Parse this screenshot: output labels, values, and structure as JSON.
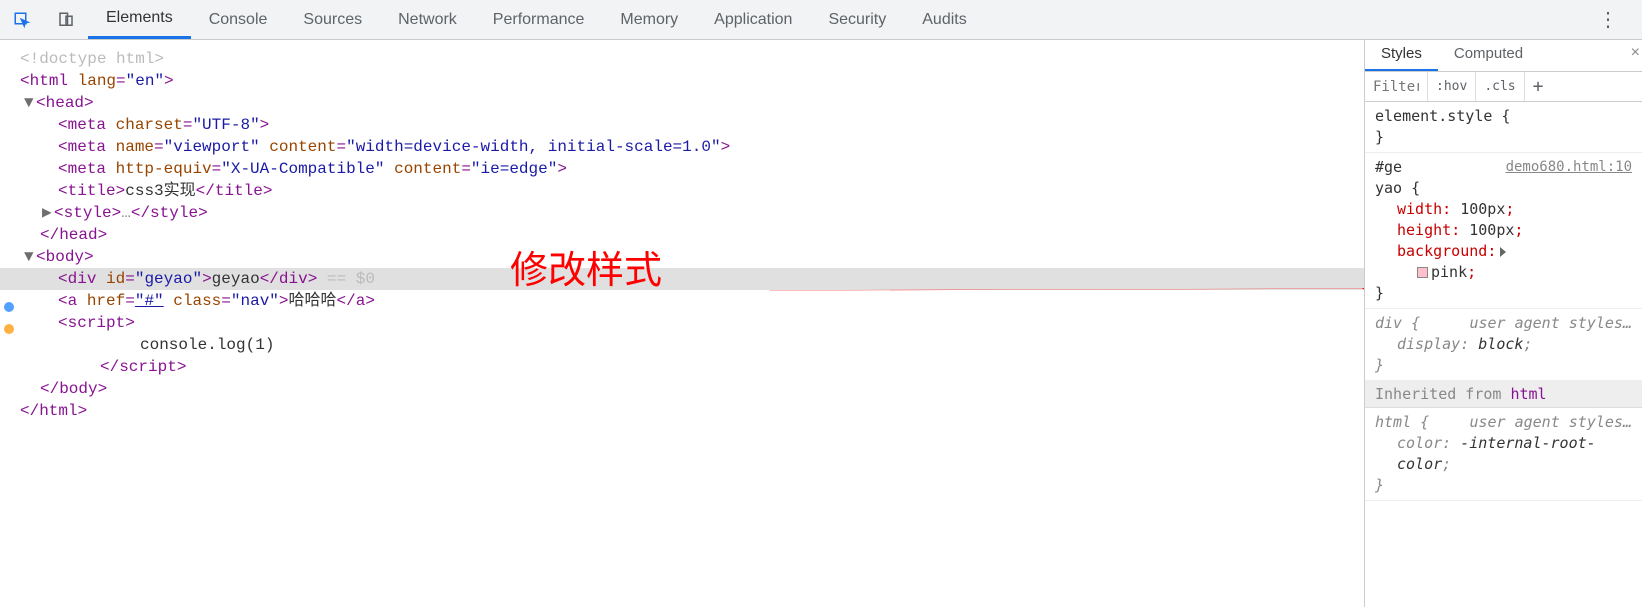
{
  "toolbar": {
    "tabs": [
      "Elements",
      "Console",
      "Sources",
      "Network",
      "Performance",
      "Memory",
      "Application",
      "Security",
      "Audits"
    ],
    "active_tab": "Elements"
  },
  "annotation": {
    "text": "修改样式"
  },
  "dom": {
    "doctype": "<!doctype html>",
    "html_open_tag": "html",
    "html_attr": "lang",
    "html_val": "\"en\"",
    "head_tag": "head",
    "meta1_tag": "meta",
    "meta1_a1": "charset",
    "meta1_v1": "\"UTF-8\"",
    "meta2_tag": "meta",
    "meta2_a1": "name",
    "meta2_v1": "\"viewport\"",
    "meta2_a2": "content",
    "meta2_v2": "\"width=device-width, initial-scale=1.0\"",
    "meta3_tag": "meta",
    "meta3_a1": "http-equiv",
    "meta3_v1": "\"X-UA-Compatible\"",
    "meta3_a2": "content",
    "meta3_v2": "\"ie=edge\"",
    "title_tag": "title",
    "title_text": "css3实现",
    "style_tag": "style",
    "style_ell": "…",
    "head_close": "head",
    "body_tag": "body",
    "div_tag": "div",
    "div_a1": "id",
    "div_v1": "\"geyao\"",
    "div_text": "geyao",
    "sel_marker": " == $0",
    "a_tag": "a",
    "a_a1": "href",
    "a_v1": "\"#\"",
    "a_a2": "class",
    "a_v2": "\"nav\"",
    "a_text": "哈哈哈",
    "script_tag": "script",
    "script_text": "console.log(1)",
    "body_close": "body",
    "html_close": "html"
  },
  "styles": {
    "tabs": [
      "Styles",
      "Computed"
    ],
    "active_tab": "Styles",
    "filter_placeholder": "Filter",
    "hov": ":hov",
    "cls": ".cls",
    "element_style_label": "element.style {",
    "rule1_selector": "#ge\nyao",
    "rule1_selector_a": "#ge",
    "rule1_selector_b": "yao {",
    "rule1_src": "demo680.html:10",
    "rule1_p1": "width",
    "rule1_v1": "100px",
    "rule1_p2": "height",
    "rule1_v2": "100px",
    "rule1_p3": "background",
    "rule1_v3": "pink",
    "ua_label": "user agent styles…",
    "rule2_selector": "div {",
    "rule2_p1": "display",
    "rule2_v1": "block",
    "inherited_label": "Inherited from ",
    "inherited_tag": "html",
    "rule3_selector": "html {",
    "rule3_p1": "color",
    "rule3_v1": "-internal-root-color"
  }
}
